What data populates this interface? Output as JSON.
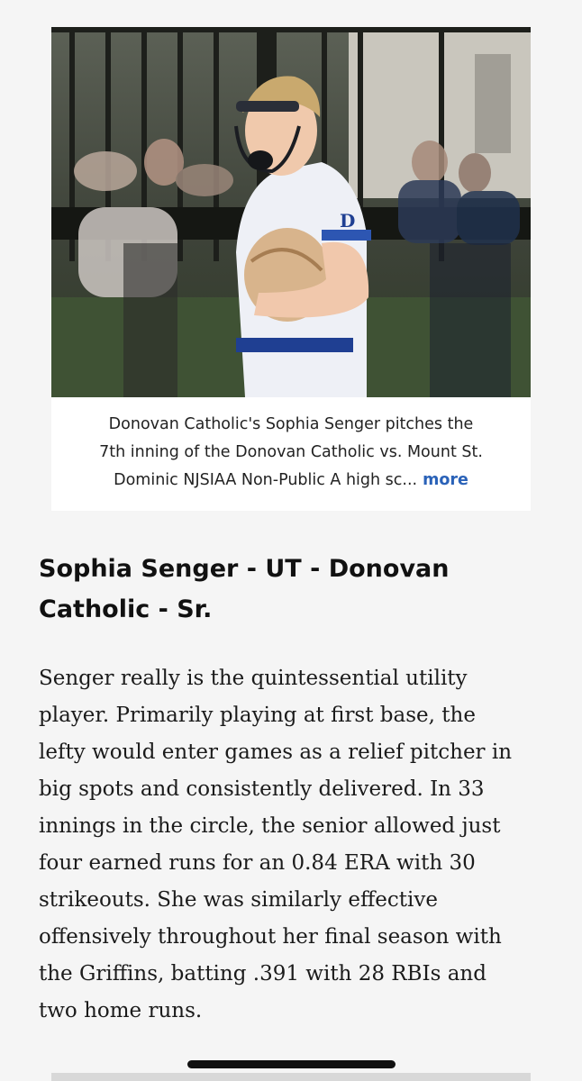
{
  "photo": {
    "image_name": "softball-pitcher-photo",
    "jersey_letter": "D",
    "caption_lines": [
      "Donovan Catholic's Sophia Senger pitches the",
      "7th inning of the Donovan Catholic vs. Mount St.",
      "Dominic NJSIAA Non-Public A high sc..."
    ],
    "more_label": "more"
  },
  "article": {
    "headline_lines": [
      "Sophia Senger - UT - Donovan",
      "Catholic - Sr."
    ],
    "body_lines": [
      "Senger really is the quintessential utility",
      "player. Primarily playing at first base, the",
      "lefty would enter games as a relief pitcher in",
      "big spots and consistently delivered. In 33",
      "innings in the circle, the senior allowed just",
      "four earned runs for an 0.84 ERA with 30",
      "strikeouts. She was similarly effective",
      "offensively throughout her final season with",
      "the Griffins, batting .391 with 28 RBIs and",
      "two home runs."
    ]
  },
  "colors": {
    "link": "#2a62b8",
    "background": "#f5f5f5"
  }
}
